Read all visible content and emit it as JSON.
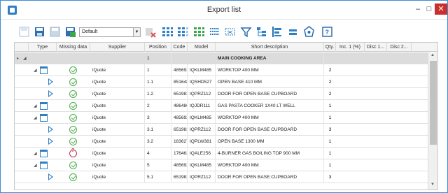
{
  "window": {
    "title": "Export list",
    "minimize": "–",
    "maximize": "□",
    "close": "✕"
  },
  "toolbar": {
    "layout_value": "Default",
    "icons": [
      "save-layout-icon",
      "save-as-icon",
      "copy-layout-icon",
      "print-icon",
      "delete-layout-icon",
      "expand-all-icon",
      "collapse-all-icon",
      "select-columns-icon",
      "column-chooser-icon",
      "group-icon",
      "filter-icon",
      "tree-icon",
      "align-left-icon",
      "align-center-icon",
      "export-icon",
      "help-icon"
    ]
  },
  "columns": [
    "Type",
    "Missing data",
    "Supplier",
    "Position",
    "Code",
    "Model",
    "Short description",
    "Qty.",
    "Inc. 1 (%)",
    "Disc 1...",
    "Disc 2..."
  ],
  "rows": [
    {
      "kind": "group",
      "position": "1",
      "description": "MAIN COOKING AREA"
    },
    {
      "kind": "cab",
      "status": "ok",
      "supplier": "iQuote",
      "position": "1",
      "code": "485692",
      "model": "IQKLM485",
      "description": "WORKTOP 400 MM",
      "qty": "2"
    },
    {
      "kind": "door",
      "status": "ok",
      "supplier": "iQuote",
      "position": "1.1",
      "code": "851648",
      "model": "IQSHD527",
      "description": "OPEN BASE 410 MM",
      "qty": "2"
    },
    {
      "kind": "door",
      "status": "ok",
      "supplier": "iQuote",
      "position": "1.2",
      "code": "651983",
      "model": "IQPRZ112",
      "description": "DOOR FOR OPEN BASE CUPBOARD",
      "qty": "2"
    },
    {
      "kind": "cab",
      "status": "ok",
      "supplier": "iQuote",
      "position": "2",
      "code": "486486",
      "model": "IQJDR111",
      "description": "GAS PASTA COOKER 1X40 LT WELL",
      "qty": "1"
    },
    {
      "kind": "cab",
      "status": "ok",
      "supplier": "iQuote",
      "position": "3",
      "code": "485692",
      "model": "IQKLM485",
      "description": "WORKTOP 400 MM",
      "qty": "1"
    },
    {
      "kind": "door",
      "status": "ok",
      "supplier": "iQuote",
      "position": "3.1",
      "code": "651983",
      "model": "IQPRZ112",
      "description": "DOOR FOR OPEN BASE CUPBOARD",
      "qty": "3"
    },
    {
      "kind": "door",
      "status": "ok",
      "supplier": "iQuote",
      "position": "3.2",
      "code": "183627",
      "model": "IQPLW381",
      "description": "OPEN BASE 1300 MM",
      "qty": "1"
    },
    {
      "kind": "cab",
      "status": "warn",
      "supplier": "iQuote",
      "position": "4",
      "code": "176463",
      "model": "IQALE256",
      "description": "4-BURNER GAS BOILING TOP 900 MM",
      "qty": "1"
    },
    {
      "kind": "cab",
      "status": "ok",
      "supplier": "iQuote",
      "position": "5",
      "code": "485692",
      "model": "IQKLM485",
      "description": "WORKTOP 400 MM",
      "qty": "1"
    },
    {
      "kind": "door",
      "status": "ok",
      "supplier": "iQuote",
      "position": "5.1",
      "code": "651983",
      "model": "IQPRZ112",
      "description": "DOOR FOR OPEN BASE CUPBOARD",
      "qty": "3"
    }
  ]
}
